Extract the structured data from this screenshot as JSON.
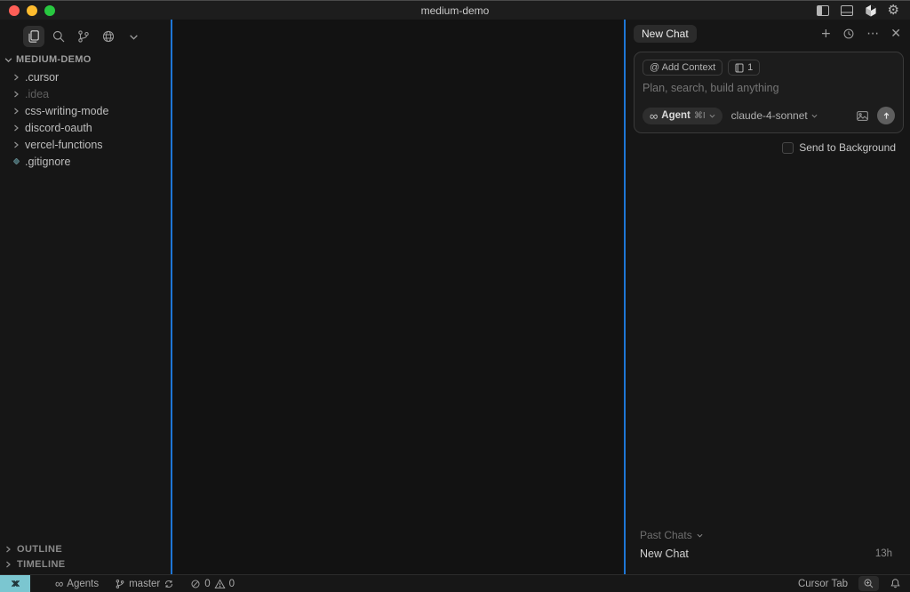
{
  "window": {
    "title": "medium-demo"
  },
  "sidebar": {
    "project": "MEDIUM-DEMO",
    "items": [
      {
        "label": ".cursor"
      },
      {
        "label": ".idea"
      },
      {
        "label": "css-writing-mode"
      },
      {
        "label": "discord-oauth"
      },
      {
        "label": "vercel-functions"
      },
      {
        "label": ".gitignore"
      }
    ],
    "outline_label": "OUTLINE",
    "timeline_label": "TIMELINE"
  },
  "chat": {
    "tab_label": "New Chat",
    "add_context_label": "@ Add Context",
    "tabs_badge": "1",
    "input_placeholder": "Plan, search, build anything",
    "agent_label": "Agent",
    "agent_shortcut": "⌘I",
    "model_label": "claude-4-sonnet",
    "send_to_background_label": "Send to Background",
    "past_chats_label": "Past Chats",
    "history": [
      {
        "title": "New Chat",
        "time": "13h"
      }
    ]
  },
  "status_bar": {
    "agents_label": "Agents",
    "branch": "master",
    "errors": "0",
    "warnings": "0",
    "cursor_tab_label": "Cursor Tab"
  },
  "icons": {
    "plus": "+",
    "more": "⋯",
    "close": "✕",
    "gear": "⚙",
    "infinity": "∞"
  },
  "colors": {
    "separator_blue": "#1e76d6",
    "remote_bg": "#7bc6d0",
    "traffic_red": "#ff5f57",
    "traffic_yellow": "#febc2e",
    "traffic_green": "#28c840",
    "panel_bg": "#161616",
    "editor_bg": "#121212"
  }
}
